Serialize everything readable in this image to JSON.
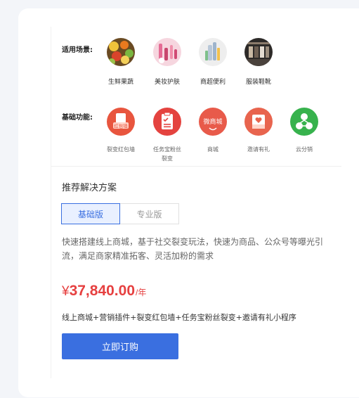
{
  "scenes": {
    "label": "适用场景:",
    "items": [
      {
        "name": "生鲜果蔬",
        "icon": "fresh-produce-photo"
      },
      {
        "name": "美妆护肤",
        "icon": "cosmetics-photo"
      },
      {
        "name": "商超便利",
        "icon": "supermarket-photo"
      },
      {
        "name": "服装鞋靴",
        "icon": "clothing-store-photo"
      }
    ]
  },
  "features": {
    "label": "基础功能:",
    "items": [
      {
        "name": "裂变红包墙",
        "badge": "红包墙",
        "icon": "red-envelope-icon",
        "color": "#e8553e"
      },
      {
        "name": "任务宝粉丝\n裂变",
        "icon": "task-list-icon",
        "color": "#e4433f"
      },
      {
        "name": "商城",
        "badge": "微商城",
        "icon": "mall-icon",
        "color": "#e85a4a"
      },
      {
        "name": "邀请有礼",
        "icon": "invitation-icon",
        "color": "#e8644e"
      },
      {
        "name": "云分销",
        "icon": "distribution-icon",
        "color": "#37b24d"
      }
    ]
  },
  "solution": {
    "title": "推荐解决方案",
    "tabs": [
      {
        "label": "基础版",
        "active": true
      },
      {
        "label": "专业版",
        "active": false
      }
    ],
    "description": "快速搭建线上商城，基于社交裂变玩法，快速为商品、公众号等曝光引流，满足商家精准拓客、灵活加粉的需求",
    "price": {
      "currency": "¥",
      "amount": "37,840.00",
      "unit": "/年"
    },
    "includes": "线上商城+营销插件+裂变红包墙+任务宝粉丝裂变+邀请有礼小程序",
    "buy_label": "立即订购"
  },
  "colors": {
    "accent": "#3a6fe0",
    "price": "#e64040"
  }
}
